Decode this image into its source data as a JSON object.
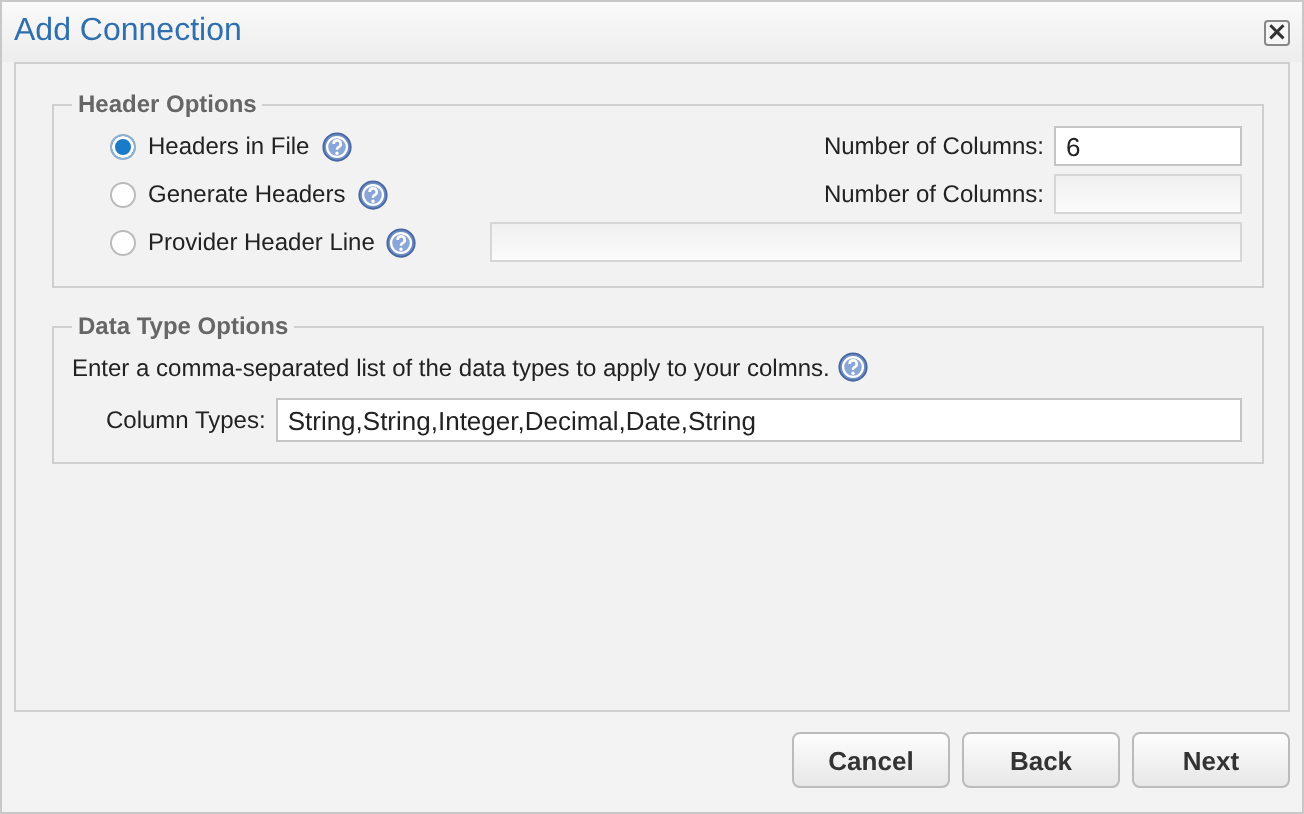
{
  "window": {
    "title": "Add Connection",
    "close": "×"
  },
  "header_options": {
    "legend": "Header Options",
    "rows": [
      {
        "label": "Headers in File",
        "selected": true,
        "field": {
          "label": "Number of Columns:",
          "value": "6",
          "disabled": false
        }
      },
      {
        "label": "Generate Headers",
        "selected": false,
        "field": {
          "label": "Number of Columns:",
          "disabled": true
        }
      },
      {
        "label": "Provider Header Line",
        "selected": false,
        "field": {
          "disabled": true
        }
      }
    ]
  },
  "data_type_options": {
    "legend": "Data Type Options",
    "description": "Enter a comma-separated list of the data types to apply to your colmns.",
    "field": {
      "label": "Column Types:",
      "value": "String,String,Integer,Decimal,Date,String"
    }
  },
  "buttons": [
    "Cancel",
    "Back",
    "Next"
  ]
}
